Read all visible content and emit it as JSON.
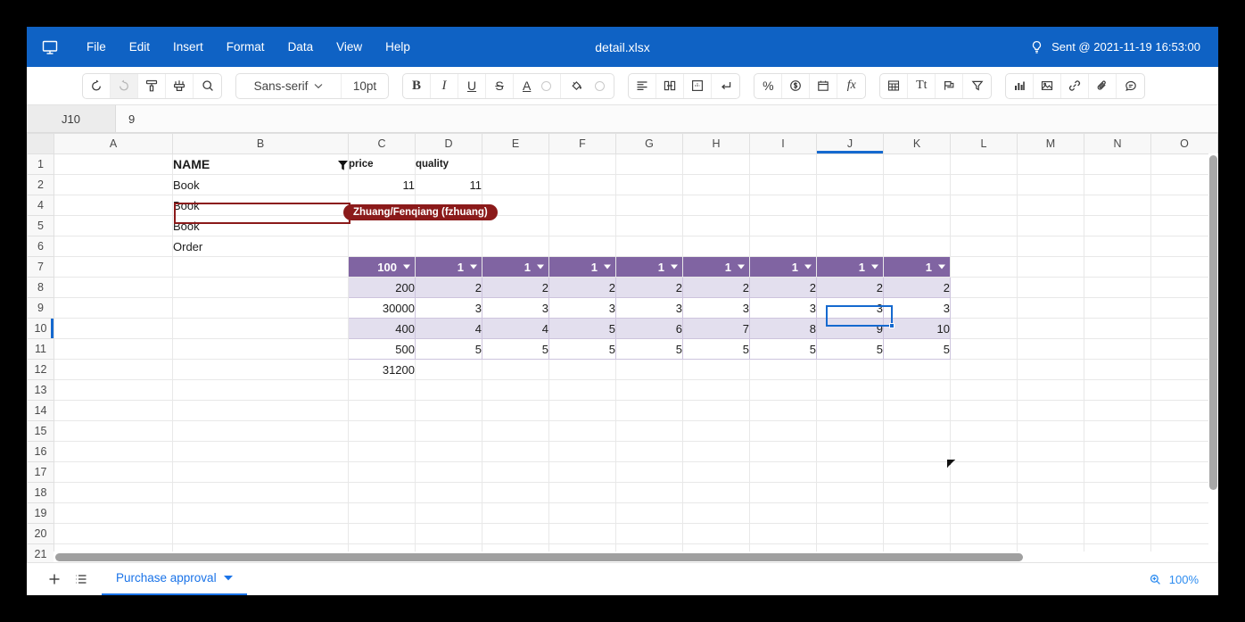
{
  "window": {
    "title": "detail.xlsx",
    "app_icon": "monitor-icon"
  },
  "menubar": {
    "items": [
      {
        "label": "File"
      },
      {
        "label": "Edit"
      },
      {
        "label": "Insert"
      },
      {
        "label": "Format"
      },
      {
        "label": "Data"
      },
      {
        "label": "View"
      },
      {
        "label": "Help"
      }
    ]
  },
  "status": {
    "icon": "lightbulb-icon",
    "text": "Sent @ 2021-11-19 16:53:00"
  },
  "toolbar": {
    "groups": [
      {
        "name": "history",
        "buttons": [
          {
            "name": "undo-button",
            "icon": "undo-icon",
            "label": ""
          },
          {
            "name": "redo-button",
            "icon": "redo-icon",
            "label": "",
            "disabled": true
          },
          {
            "name": "format-painter-roller-button",
            "icon": "paint-roller-icon",
            "label": ""
          },
          {
            "name": "clear-format-brush-button",
            "icon": "paint-brush-icon",
            "label": ""
          },
          {
            "name": "find-button",
            "icon": "search-icon",
            "label": ""
          }
        ]
      },
      {
        "name": "font",
        "font_family": "Sans-serif",
        "font_size": "10pt"
      },
      {
        "name": "text-style",
        "buttons": [
          {
            "name": "bold-button",
            "icon": "bold-icon",
            "label": "B"
          },
          {
            "name": "italic-button",
            "icon": "italic-icon",
            "label": "I"
          },
          {
            "name": "underline-button",
            "icon": "underline-icon",
            "label": "U"
          },
          {
            "name": "strikethrough-button",
            "icon": "strikethrough-icon",
            "label": "S"
          },
          {
            "name": "text-color-button",
            "icon": "text-color-icon",
            "label": "A"
          },
          {
            "name": "fill-color-button",
            "icon": "fill-color-icon",
            "label": ""
          }
        ]
      },
      {
        "name": "alignment",
        "buttons": [
          {
            "name": "align-left-button",
            "icon": "align-left-icon"
          },
          {
            "name": "merge-cells-button",
            "icon": "merge-cells-icon"
          },
          {
            "name": "borders-button",
            "icon": "borders-icon"
          },
          {
            "name": "wrap-text-button",
            "icon": "wrap-text-icon"
          }
        ]
      },
      {
        "name": "number-format",
        "buttons": [
          {
            "name": "percent-format-button",
            "icon": "percent-icon",
            "label": "%"
          },
          {
            "name": "currency-format-button",
            "icon": "currency-icon"
          },
          {
            "name": "date-format-button",
            "icon": "calendar-icon"
          },
          {
            "name": "formula-button",
            "icon": "function-icon",
            "label": "fx"
          }
        ]
      },
      {
        "name": "insert-objects",
        "buttons": [
          {
            "name": "insert-table-button",
            "icon": "table-icon"
          },
          {
            "name": "text-format-button",
            "icon": "text-size-icon",
            "label": "Tt"
          },
          {
            "name": "insert-banner-button",
            "icon": "flag-icon"
          },
          {
            "name": "filter-button",
            "icon": "funnel-icon"
          }
        ]
      },
      {
        "name": "media",
        "buttons": [
          {
            "name": "insert-chart-button",
            "icon": "bar-chart-icon"
          },
          {
            "name": "insert-image-button",
            "icon": "image-icon"
          },
          {
            "name": "insert-link-button",
            "icon": "link-icon"
          },
          {
            "name": "attach-file-button",
            "icon": "paperclip-icon"
          },
          {
            "name": "insert-comment-button",
            "icon": "comment-icon"
          }
        ]
      }
    ]
  },
  "formula_bar": {
    "name_box": "J10",
    "formula_value": "9"
  },
  "grid": {
    "columns": [
      "A",
      "B",
      "C",
      "D",
      "E",
      "F",
      "G",
      "H",
      "I",
      "J",
      "K",
      "L",
      "M",
      "N",
      "O"
    ],
    "active_column": "J",
    "active_row": "10",
    "rows": [
      {
        "num": "1",
        "cells": {
          "B": "NAME",
          "C": "price",
          "D": "quality"
        }
      },
      {
        "num": "2",
        "cells": {
          "B": "Book",
          "C": "11",
          "D": "11"
        }
      },
      {
        "num": "4",
        "cells": {
          "B": "Book"
        }
      },
      {
        "num": "5",
        "cells": {
          "B": "Book"
        }
      },
      {
        "num": "6",
        "cells": {
          "B": "Order"
        }
      },
      {
        "num": "7",
        "cells": {
          "C": "100",
          "D": "1",
          "E": "1",
          "F": "1",
          "G": "1",
          "H": "1",
          "I": "1",
          "J": "1",
          "K": "1"
        }
      },
      {
        "num": "8",
        "cells": {
          "C": "200",
          "D": "2",
          "E": "2",
          "F": "2",
          "G": "2",
          "H": "2",
          "I": "2",
          "J": "2",
          "K": "2"
        }
      },
      {
        "num": "9",
        "cells": {
          "C": "30000",
          "D": "3",
          "E": "3",
          "F": "3",
          "G": "3",
          "H": "3",
          "I": "3",
          "J": "3",
          "K": "3"
        }
      },
      {
        "num": "10",
        "cells": {
          "C": "400",
          "D": "4",
          "E": "4",
          "F": "5",
          "G": "6",
          "H": "7",
          "I": "8",
          "J": "9",
          "K": "10"
        }
      },
      {
        "num": "11",
        "cells": {
          "C": "500",
          "D": "5",
          "E": "5",
          "F": "5",
          "G": "5",
          "H": "5",
          "I": "5",
          "J": "5",
          "K": "5"
        }
      },
      {
        "num": "12",
        "cells": {
          "C": "31200"
        }
      },
      {
        "num": "13",
        "cells": {}
      },
      {
        "num": "14",
        "cells": {}
      },
      {
        "num": "15",
        "cells": {}
      },
      {
        "num": "16",
        "cells": {}
      },
      {
        "num": "17",
        "cells": {}
      },
      {
        "num": "18",
        "cells": {}
      },
      {
        "num": "19",
        "cells": {}
      },
      {
        "num": "20",
        "cells": {}
      },
      {
        "num": "21",
        "cells": {}
      }
    ],
    "selection": {
      "cell": "J10",
      "value": "9"
    },
    "collaborator": {
      "cell": "B5",
      "label": "Zhuang/Fenqiang (fzhuang)",
      "color": "#8B1A1A"
    },
    "table_header_color": "#8064A2",
    "table_band_color": "#E3DFEE",
    "filter_indicator_cell": "B1"
  },
  "bottom_bar": {
    "add_sheet_label": "+",
    "sheet_list_icon": "list-icon",
    "sheet_tab": "Purchase approval",
    "zoom_icon": "zoom-in-icon",
    "zoom_level": "100%"
  }
}
